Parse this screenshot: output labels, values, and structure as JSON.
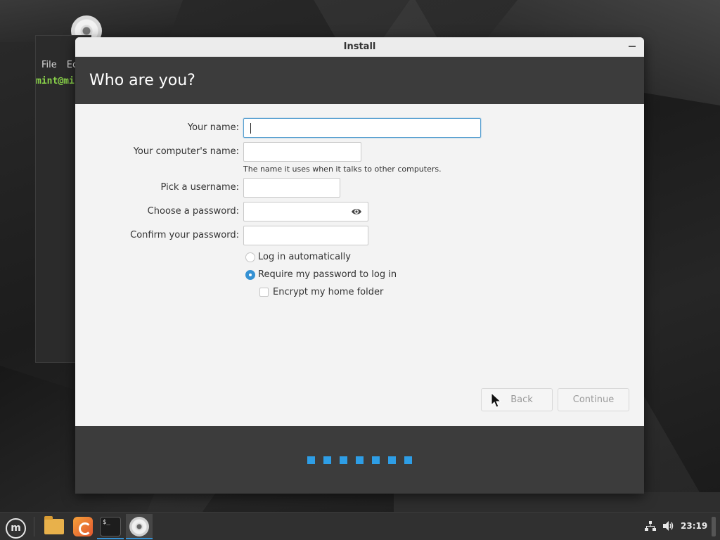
{
  "window": {
    "title": "Install"
  },
  "header": {
    "title": "Who are you?"
  },
  "terminal": {
    "menu": [
      "File",
      "Ec"
    ],
    "prompt": "mint@mi"
  },
  "form": {
    "your_name_label": "Your name:",
    "your_name_value": "",
    "computer_name_label": "Your computer's name:",
    "computer_name_value": "",
    "computer_name_hint": "The name it uses when it talks to other computers.",
    "username_label": "Pick a username:",
    "username_value": "",
    "password_label": "Choose a password:",
    "password_value": "",
    "confirm_password_label": "Confirm your password:",
    "confirm_password_value": "",
    "login_auto_label": "Log in automatically",
    "login_auto_checked": false,
    "require_password_label": "Require my password to log in",
    "require_password_checked": true,
    "encrypt_home_label": "Encrypt my home folder",
    "encrypt_home_checked": false
  },
  "buttons": {
    "back": "Back",
    "continue": "Continue"
  },
  "progress": {
    "steps": 7,
    "current": 7
  },
  "taskbar": {
    "items": [
      "mint-menu-icon",
      "folder-icon",
      "firefox-icon",
      "terminal-icon",
      "disc-icon"
    ],
    "terminal_glyph": "$_",
    "menu_glyph": "m",
    "clock": "23:19"
  },
  "colors": {
    "accent": "#3591d3",
    "progress": "#2e9ee6",
    "header_bg": "#3c3c3c"
  }
}
